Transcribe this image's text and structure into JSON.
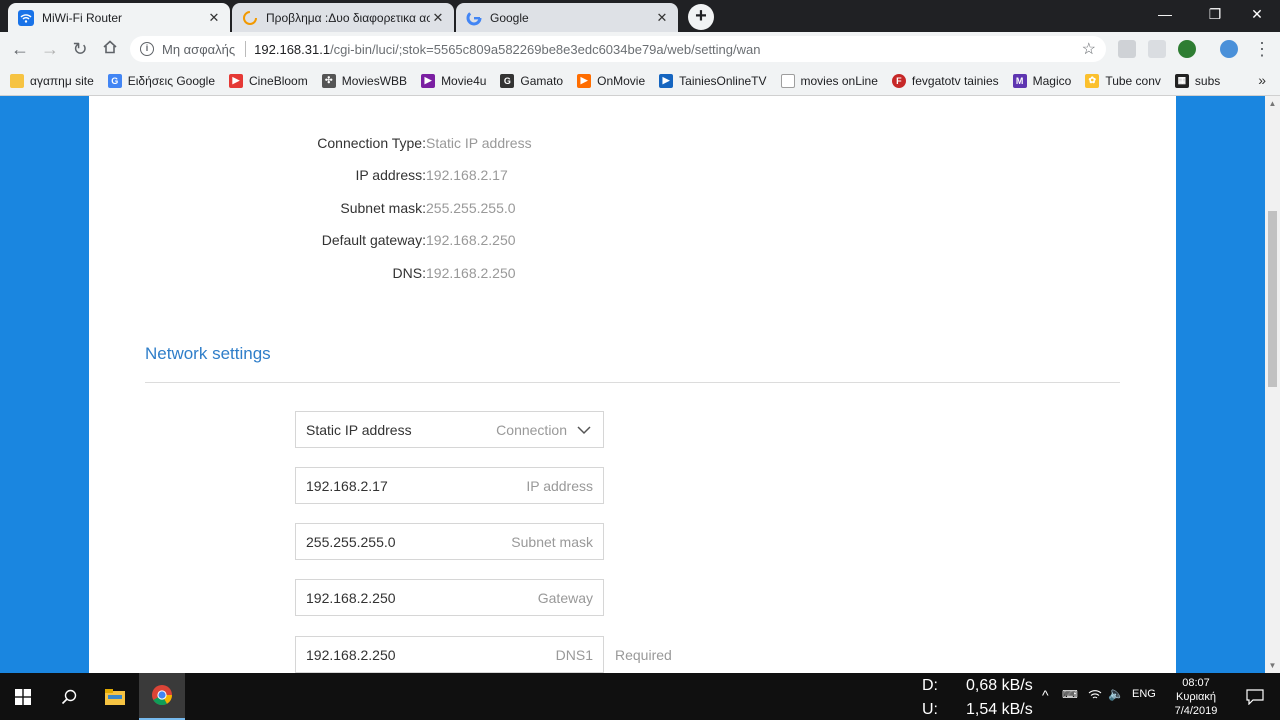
{
  "browser": {
    "tabs": [
      {
        "title": "MiWi-Fi Router",
        "icon": "wifi-icon"
      },
      {
        "title": "Προβλημα :Δυο διαφορετικα ασ",
        "icon": "loading-icon"
      },
      {
        "title": "Google",
        "icon": "google-icon"
      }
    ],
    "address": {
      "security_label": "Μη ασφαλής",
      "host": "192.168.31.1",
      "path": "/cgi-bin/luci/;stok=5565c809a582269be8e3edc6034be79a/web/setting/wan"
    },
    "bookmarks": [
      {
        "label": "αγαπημ site",
        "icon": "folder-icon",
        "color": "#f6c342"
      },
      {
        "label": "Ειδήσεις Google",
        "icon": "google-news-icon",
        "color": "#4285f4"
      },
      {
        "label": "CineBloom",
        "icon": "cinebloom-icon",
        "color": "#e53935"
      },
      {
        "label": "MoviesWBB",
        "icon": "movieswbb-icon",
        "color": "#555555"
      },
      {
        "label": "Movie4u",
        "icon": "movie4u-icon",
        "color": "#7b1fa2"
      },
      {
        "label": "Gamato",
        "icon": "gamato-icon",
        "color": "#333333"
      },
      {
        "label": "OnMovie",
        "icon": "onmovie-icon",
        "color": "#ff6d00"
      },
      {
        "label": "TainiesOnlineTV",
        "icon": "tainiesonline-icon",
        "color": "#1565c0"
      },
      {
        "label": "movies onLine",
        "icon": "page-icon",
        "color": "#9e9e9e"
      },
      {
        "label": "fevgatotv tainies",
        "icon": "fevgato-icon",
        "color": "#c62828"
      },
      {
        "label": "Magico",
        "icon": "magico-icon",
        "color": "#5e35b1"
      },
      {
        "label": "Tube conv",
        "icon": "tubeconv-icon",
        "color": "#fbc02d"
      },
      {
        "label": "subs",
        "icon": "subs-icon",
        "color": "#222222"
      }
    ]
  },
  "status": {
    "rows": [
      {
        "label": "Connection Type:",
        "value": "Static IP address"
      },
      {
        "label": "IP address:",
        "value": "192.168.2.17"
      },
      {
        "label": "Subnet mask:",
        "value": "255.255.255.0"
      },
      {
        "label": "Default gateway:",
        "value": "192.168.2.250"
      },
      {
        "label": "DNS:",
        "value": "192.168.2.250"
      }
    ]
  },
  "network_settings": {
    "title": "Network settings",
    "connection": {
      "value": "Static IP address",
      "placeholder": "Connection"
    },
    "ip": {
      "value": "192.168.2.17",
      "placeholder": "IP address"
    },
    "mask": {
      "value": "255.255.255.0",
      "placeholder": "Subnet mask"
    },
    "gateway": {
      "value": "192.168.2.250",
      "placeholder": "Gateway"
    },
    "dns1": {
      "value": "192.168.2.250",
      "placeholder": "DNS1",
      "note": "Required"
    }
  },
  "taskbar": {
    "net_down_label": "D:",
    "net_down_value": "0,68 kB/s",
    "net_up_label": "U:",
    "net_up_value": "1,54 kB/s",
    "language": "ENG",
    "time": "08:07",
    "day": "Κυριακή",
    "date": "7/4/2019"
  }
}
